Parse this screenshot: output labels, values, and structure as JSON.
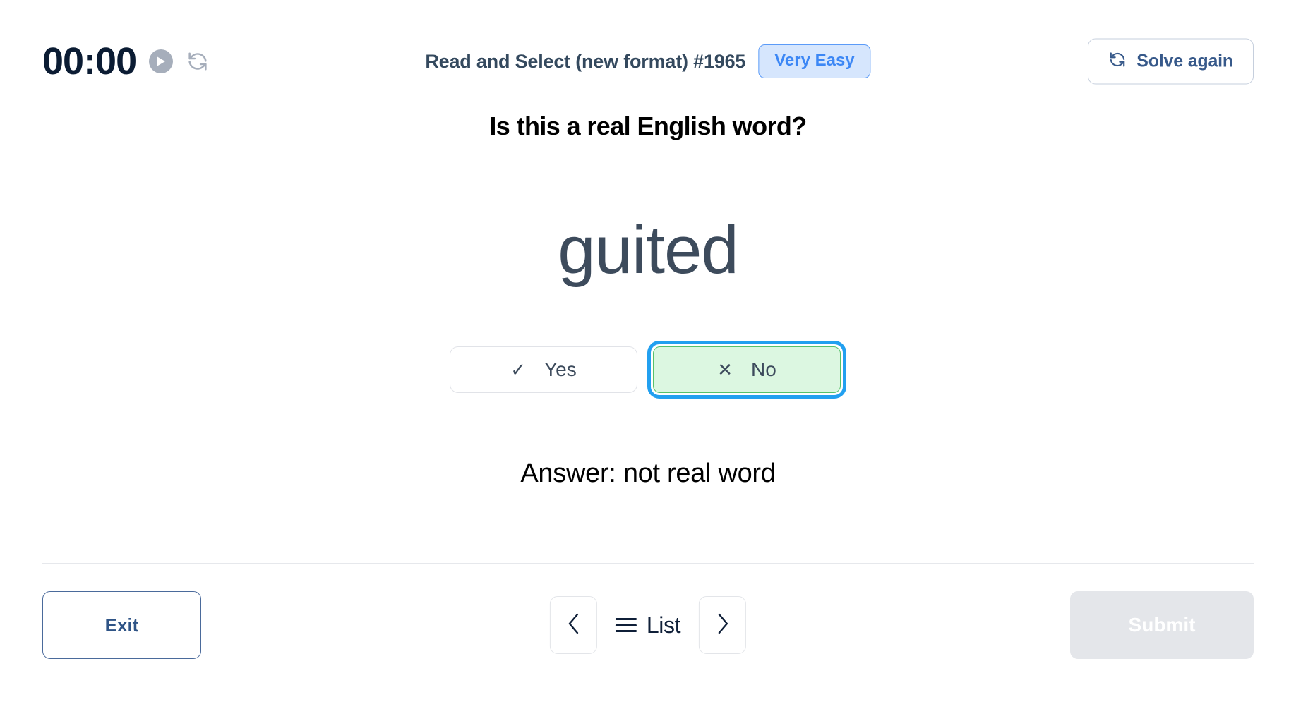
{
  "header": {
    "timer": "00:00",
    "play_icon": "play-icon",
    "reset_icon": "reset-icon",
    "puzzle_title": "Read and Select (new format) #1965",
    "difficulty_label": "Very Easy",
    "solve_again_label": "Solve again",
    "solve_again_icon": "refresh-icon"
  },
  "main": {
    "question": "Is this a real English word?",
    "word": "guited",
    "choices": [
      {
        "label": "Yes",
        "glyph": "✓",
        "icon_name": "check-icon",
        "selected": false
      },
      {
        "label": "No",
        "glyph": "✕",
        "icon_name": "cross-icon",
        "selected": true
      }
    ],
    "answer_text": "Answer: not real word"
  },
  "footer": {
    "exit_label": "Exit",
    "prev_icon": "chevron-left-icon",
    "next_icon": "chevron-right-icon",
    "list_label": "List",
    "list_icon": "hamburger-icon",
    "submit_label": "Submit",
    "submit_disabled": true
  },
  "colors": {
    "accent_blue": "#3c87f5",
    "focus_ring": "#22a0f0",
    "selected_green_bg": "#dcf7e1",
    "selected_green_border": "#57c16a",
    "navy": "#0b1c33",
    "slate": "#3d4b5c",
    "disabled_gray": "#e4e6ea"
  }
}
